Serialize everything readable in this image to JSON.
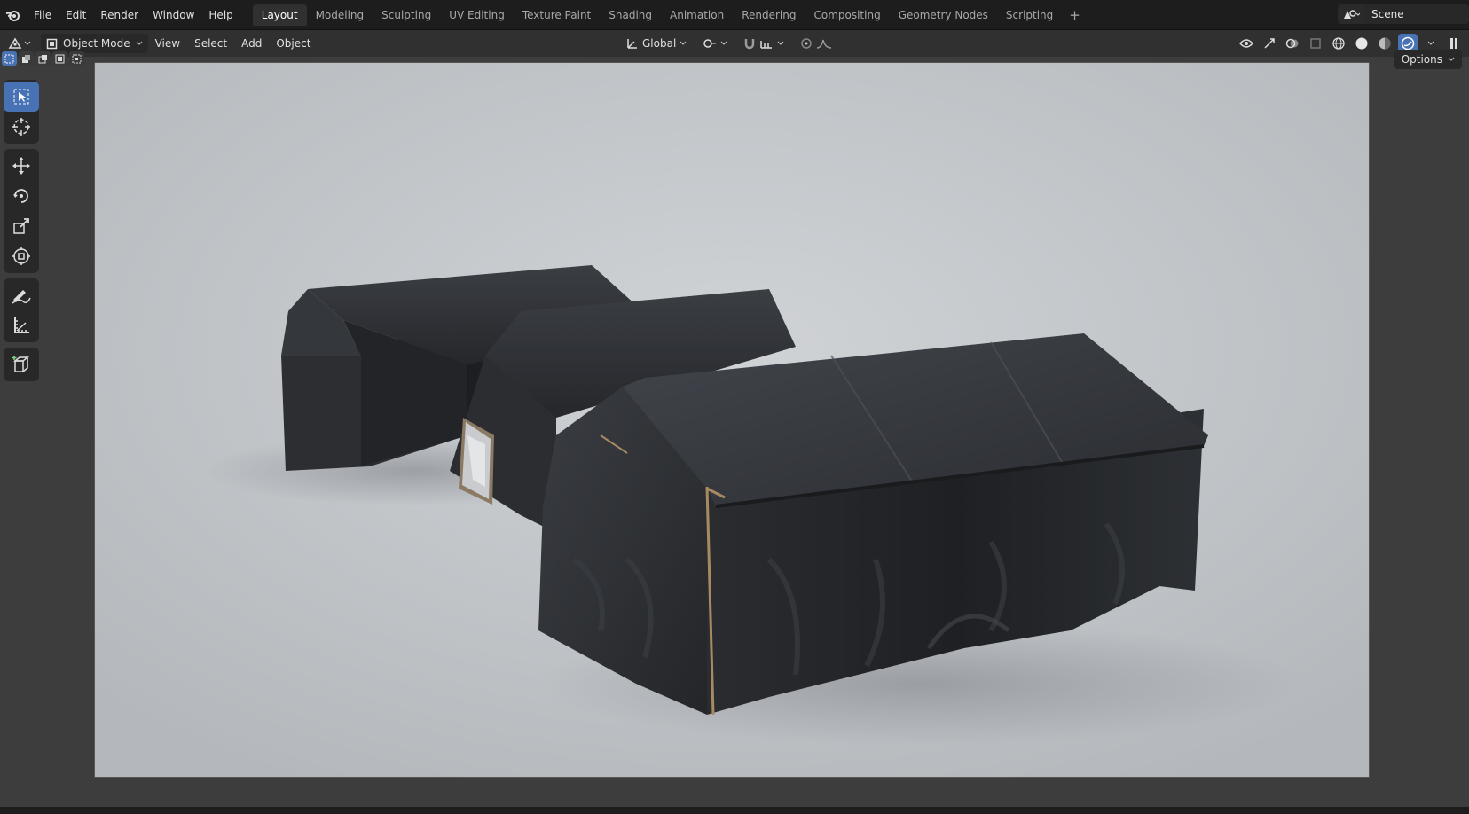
{
  "menu": {
    "file": "File",
    "edit": "Edit",
    "render": "Render",
    "window": "Window",
    "help": "Help"
  },
  "workspaces": [
    "Layout",
    "Modeling",
    "Sculpting",
    "UV Editing",
    "Texture Paint",
    "Shading",
    "Animation",
    "Rendering",
    "Compositing",
    "Geometry Nodes",
    "Scripting"
  ],
  "active_workspace": "Layout",
  "scene": {
    "name": "Scene"
  },
  "header": {
    "mode": "Object Mode",
    "view": "View",
    "select": "Select",
    "add": "Add",
    "object": "Object",
    "transform_orientation": "Global",
    "options": "Options"
  },
  "toolbar": {
    "tools": [
      "select-box",
      "cursor",
      "move",
      "rotate",
      "scale",
      "transform",
      "annotate",
      "measure",
      "add-cube"
    ],
    "active": "select-box"
  },
  "viewport": {
    "shading": "rendered",
    "background": "#c3c6c9",
    "objects": [
      "tent-left",
      "tent-middle",
      "tent-front"
    ]
  },
  "colors": {
    "accent": "#4772b3",
    "header": "#303030",
    "topbar": "#1d1d1d"
  }
}
